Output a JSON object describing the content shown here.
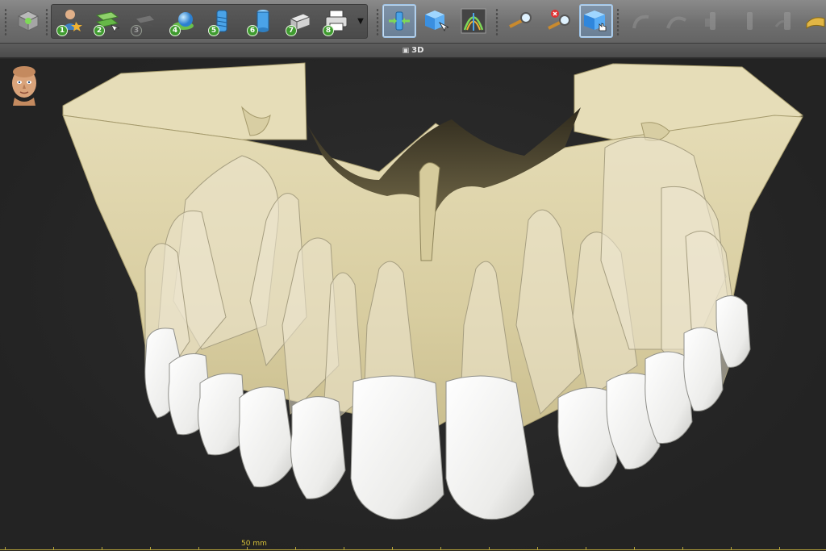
{
  "view": {
    "title": "3D",
    "scale_label": "50 mm"
  },
  "toolbar": {
    "workflow_steps": [
      {
        "number": "1",
        "icon": "patient-icon",
        "active": true
      },
      {
        "number": "2",
        "icon": "curve-icon",
        "active": true
      },
      {
        "number": "3",
        "icon": "nerve-icon",
        "active": false
      },
      {
        "number": "4",
        "icon": "sphere-icon",
        "active": true
      },
      {
        "number": "5",
        "icon": "implant-icon",
        "active": true
      },
      {
        "number": "6",
        "icon": "abutment-icon",
        "active": true
      },
      {
        "number": "7",
        "icon": "sleeve-icon",
        "active": true
      },
      {
        "number": "8",
        "icon": "printer-icon",
        "active": true
      }
    ]
  },
  "colors": {
    "bone": "#d9cfa6",
    "teeth": "#f4f4f0",
    "accent": "#9cc3e8",
    "scale": "#d8c23a"
  }
}
